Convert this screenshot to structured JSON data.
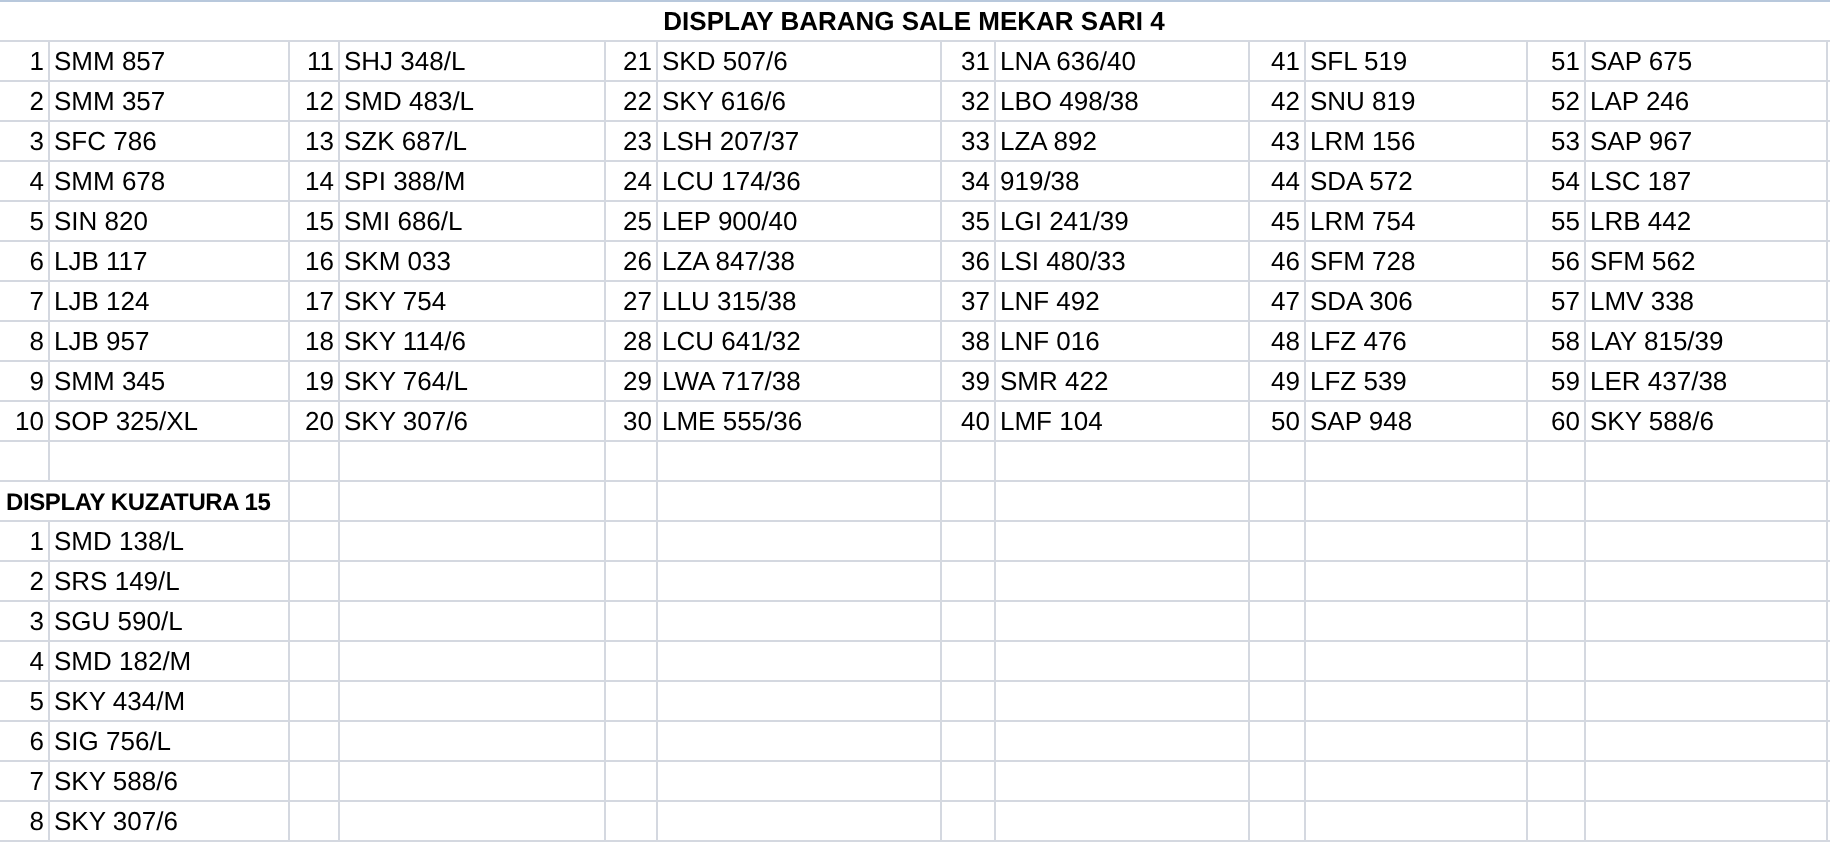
{
  "sections": [
    {
      "kind": "banner",
      "title": "DISPLAY BARANG SALE MEKAR SARI 4",
      "items": [
        {
          "number": "1",
          "code": "SMM 857"
        },
        {
          "number": "2",
          "code": "SMM 357"
        },
        {
          "number": "3",
          "code": "SFC 786"
        },
        {
          "number": "4",
          "code": "SMM 678"
        },
        {
          "number": "5",
          "code": "SIN 820"
        },
        {
          "number": "6",
          "code": "LJB 117"
        },
        {
          "number": "7",
          "code": "LJB 124"
        },
        {
          "number": "8",
          "code": "LJB 957"
        },
        {
          "number": "9",
          "code": "SMM 345"
        },
        {
          "number": "10",
          "code": "SOP 325/XL"
        },
        {
          "number": "11",
          "code": "SHJ 348/L"
        },
        {
          "number": "12",
          "code": "SMD 483/L"
        },
        {
          "number": "13",
          "code": "SZK 687/L"
        },
        {
          "number": "14",
          "code": "SPI 388/M"
        },
        {
          "number": "15",
          "code": "SMI 686/L"
        },
        {
          "number": "16",
          "code": "SKM 033"
        },
        {
          "number": "17",
          "code": "SKY 754"
        },
        {
          "number": "18",
          "code": "SKY 114/6"
        },
        {
          "number": "19",
          "code": "SKY 764/L"
        },
        {
          "number": "20",
          "code": "SKY 307/6"
        },
        {
          "number": "21",
          "code": "SKD 507/6"
        },
        {
          "number": "22",
          "code": "SKY 616/6"
        },
        {
          "number": "23",
          "code": "LSH 207/37"
        },
        {
          "number": "24",
          "code": "LCU 174/36"
        },
        {
          "number": "25",
          "code": "LEP 900/40"
        },
        {
          "number": "26",
          "code": "LZA 847/38"
        },
        {
          "number": "27",
          "code": "LLU 315/38"
        },
        {
          "number": "28",
          "code": "LCU 641/32"
        },
        {
          "number": "29",
          "code": "LWA 717/38"
        },
        {
          "number": "30",
          "code": "LME 555/36"
        },
        {
          "number": "31",
          "code": "LNA 636/40"
        },
        {
          "number": "32",
          "code": "LBO 498/38"
        },
        {
          "number": "33",
          "code": "LZA 892"
        },
        {
          "number": "34",
          "code": "919/38"
        },
        {
          "number": "35",
          "code": "LGI 241/39"
        },
        {
          "number": "36",
          "code": "LSI 480/33"
        },
        {
          "number": "37",
          "code": "LNF 492"
        },
        {
          "number": "38",
          "code": "LNF 016"
        },
        {
          "number": "39",
          "code": "SMR 422"
        },
        {
          "number": "40",
          "code": "LMF 104"
        },
        {
          "number": "41",
          "code": "SFL 519"
        },
        {
          "number": "42",
          "code": "SNU 819"
        },
        {
          "number": "43",
          "code": "LRM 156"
        },
        {
          "number": "44",
          "code": "SDA 572"
        },
        {
          "number": "45",
          "code": "LRM 754"
        },
        {
          "number": "46",
          "code": "SFM 728"
        },
        {
          "number": "47",
          "code": "SDA 306"
        },
        {
          "number": "48",
          "code": "LFZ 476"
        },
        {
          "number": "49",
          "code": "LFZ 539"
        },
        {
          "number": "50",
          "code": "SAP 948"
        },
        {
          "number": "51",
          "code": "SAP 675"
        },
        {
          "number": "52",
          "code": "LAP 246"
        },
        {
          "number": "53",
          "code": "SAP 967"
        },
        {
          "number": "54",
          "code": "LSC 187"
        },
        {
          "number": "55",
          "code": "LRB 442"
        },
        {
          "number": "56",
          "code": "SFM 562"
        },
        {
          "number": "57",
          "code": "LMV 338"
        },
        {
          "number": "58",
          "code": "LAY 815/39"
        },
        {
          "number": "59",
          "code": "LER 437/38"
        },
        {
          "number": "60",
          "code": "SKY 588/6"
        }
      ]
    },
    {
      "kind": "heading",
      "title": "DISPLAY KUZATURA 15",
      "items": [
        {
          "number": "1",
          "code": "SMD 138/L"
        },
        {
          "number": "2",
          "code": "SRS 149/L"
        },
        {
          "number": "3",
          "code": "SGU 590/L"
        },
        {
          "number": "4",
          "code": "SMD 182/M"
        },
        {
          "number": "5",
          "code": "SKY 434/M"
        },
        {
          "number": "6",
          "code": "SIG 756/L"
        },
        {
          "number": "7",
          "code": "SKY 588/6"
        },
        {
          "number": "8",
          "code": "SKY 307/6"
        }
      ]
    }
  ]
}
